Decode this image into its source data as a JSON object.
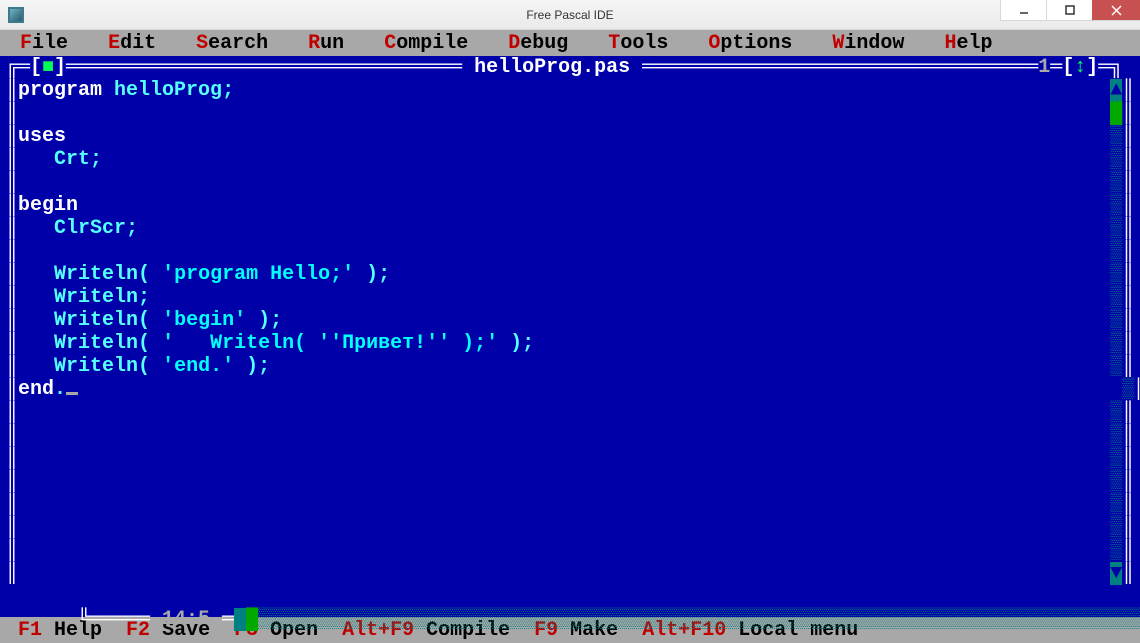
{
  "window": {
    "title": "Free Pascal IDE"
  },
  "menu": {
    "items": [
      {
        "hot": "F",
        "rest": "ile"
      },
      {
        "hot": "E",
        "rest": "dit"
      },
      {
        "hot": "S",
        "rest": "earch"
      },
      {
        "hot": "R",
        "rest": "un"
      },
      {
        "hot": "C",
        "rest": "ompile"
      },
      {
        "hot": "D",
        "rest": "ebug"
      },
      {
        "hot": "T",
        "rest": "ools"
      },
      {
        "hot": "O",
        "rest": "ptions"
      },
      {
        "hot": "W",
        "rest": "indow"
      },
      {
        "hot": "H",
        "rest": "elp"
      }
    ]
  },
  "editor": {
    "filename": "helloProg.pas",
    "window_number": "1",
    "lines": [
      {
        "t": "kw-id-sym",
        "kw": "program ",
        "id": "helloProg",
        "sym": ";"
      },
      {
        "t": "blank"
      },
      {
        "t": "kw",
        "kw": "uses"
      },
      {
        "t": "indent-id-sym",
        "indent": "   ",
        "id": "Crt",
        "sym": ";"
      },
      {
        "t": "blank"
      },
      {
        "t": "kw",
        "kw": "begin"
      },
      {
        "t": "indent-id-sym",
        "indent": "   ",
        "id": "ClrScr",
        "sym": ";"
      },
      {
        "t": "blank"
      },
      {
        "t": "call",
        "indent": "   ",
        "id": "Writeln",
        "open": "( ",
        "str": "'program Hello;'",
        "close": " )",
        "sym": ";"
      },
      {
        "t": "indent-id-sym",
        "indent": "   ",
        "id": "Writeln",
        "sym": ";"
      },
      {
        "t": "call",
        "indent": "   ",
        "id": "Writeln",
        "open": "( ",
        "str": "'begin'",
        "close": " )",
        "sym": ";"
      },
      {
        "t": "call",
        "indent": "   ",
        "id": "Writeln",
        "open": "( ",
        "str": "'   Writeln( ''Привет!'' );'",
        "close": " )",
        "sym": ";"
      },
      {
        "t": "call",
        "indent": "   ",
        "id": "Writeln",
        "open": "( ",
        "str": "'end.'",
        "close": " )",
        "sym": ";"
      },
      {
        "t": "end",
        "kw": "end",
        "sym": "."
      }
    ],
    "cursor_position": "14:5"
  },
  "status": {
    "items": [
      {
        "key": "F1",
        "label": " Help  "
      },
      {
        "key": "F2",
        "label": " Save  "
      },
      {
        "key": "F3",
        "label": " Open  "
      },
      {
        "key": "Alt+F9",
        "label": " Compile  "
      },
      {
        "key": "F9",
        "label": " Make  "
      },
      {
        "key": "Alt+F10",
        "label": " Local menu"
      }
    ]
  }
}
